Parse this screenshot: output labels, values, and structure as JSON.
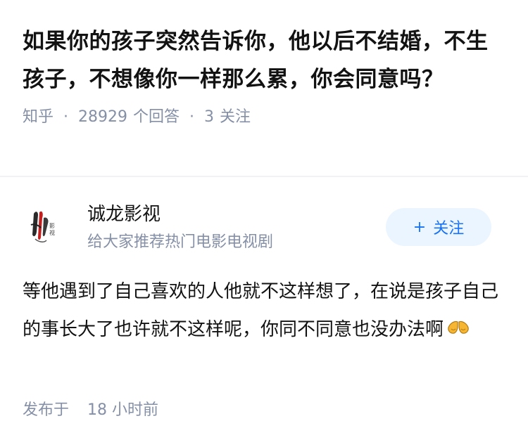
{
  "question": {
    "title": "如果你的孩子突然告诉你，他以后不结婚，不生孩子，不想像你一样那么累，你会同意吗？",
    "source": "知乎",
    "answer_count": "28929",
    "answer_count_label": "个回答",
    "follower_count": "3",
    "follower_count_label": "关注"
  },
  "author": {
    "name": "诚龙影视",
    "bio": "给大家推荐热门电影电视剧",
    "avatar_icon": "chenglong-logo-icon",
    "follow_plus": "+",
    "follow_label": "关注"
  },
  "answer": {
    "text": "等他遇到了自己喜欢的人他就不这样想了，在说是孩子自己的事长大了也许就不这样呢，你同不同意也没办法啊",
    "emoji_icon": "folded-hands-icon"
  },
  "footer": {
    "published_label": "发布于",
    "published_time": "18 小时前"
  },
  "colors": {
    "primary_text": "#121212",
    "secondary_text": "#8590a6",
    "accent_blue": "#1772f6",
    "follow_bg": "#ebf5ff"
  }
}
